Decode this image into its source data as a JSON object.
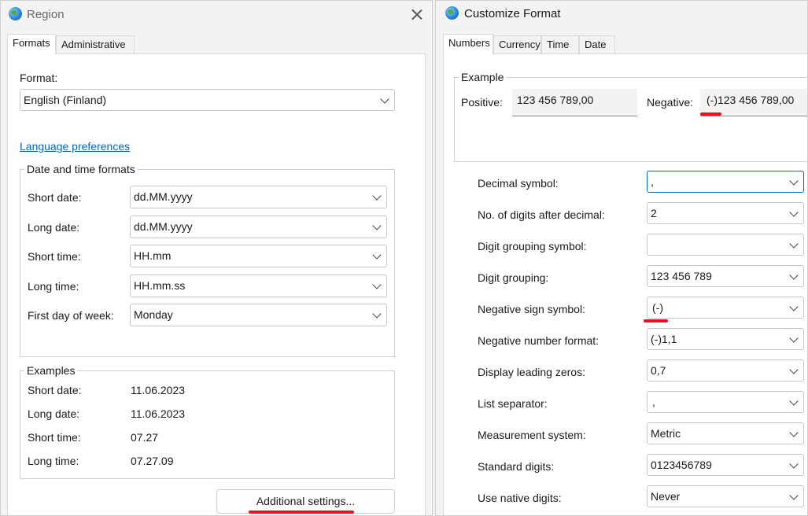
{
  "region": {
    "title": "Region",
    "tabs": [
      "Formats",
      "Administrative"
    ],
    "format_label": "Format:",
    "format_value": "English (Finland)",
    "language_link": "Language preferences",
    "datetime_group": "Date and time formats",
    "fields": [
      {
        "label": "Short date:",
        "value": "dd.MM.yyyy"
      },
      {
        "label": "Long date:",
        "value": "dd.MM.yyyy"
      },
      {
        "label": "Short time:",
        "value": "HH.mm"
      },
      {
        "label": "Long time:",
        "value": "HH.mm.ss"
      },
      {
        "label": "First day of week:",
        "value": "Monday"
      }
    ],
    "examples_group": "Examples",
    "examples": [
      {
        "label": "Short date:",
        "value": "11.06.2023"
      },
      {
        "label": "Long date:",
        "value": "11.06.2023"
      },
      {
        "label": "Short time:",
        "value": "07.27"
      },
      {
        "label": "Long time:",
        "value": "07.27.09"
      }
    ],
    "additional_button": "Additional settings..."
  },
  "customize": {
    "title": "Customize Format",
    "tabs": [
      "Numbers",
      "Currency",
      "Time",
      "Date"
    ],
    "example_group": "Example",
    "positive_label": "Positive:",
    "positive_value": "123 456 789,00",
    "negative_label": "Negative:",
    "negative_value": "(-)123 456 789,00",
    "settings": [
      {
        "label": "Decimal symbol:",
        "value": ","
      },
      {
        "label": "No. of digits after decimal:",
        "value": "2"
      },
      {
        "label": "Digit grouping symbol:",
        "value": ""
      },
      {
        "label": "Digit grouping:",
        "value": "123 456 789"
      },
      {
        "label": "Negative sign symbol:",
        "value": "(-)"
      },
      {
        "label": "Negative number format:",
        "value": "(-)1,1"
      },
      {
        "label": "Display leading zeros:",
        "value": "0,7"
      },
      {
        "label": "List separator:",
        "value": ","
      },
      {
        "label": "Measurement system:",
        "value": "Metric"
      },
      {
        "label": "Standard digits:",
        "value": "0123456789"
      },
      {
        "label": "Use native digits:",
        "value": "Never"
      }
    ]
  },
  "colors": {
    "accent": "#0067c0",
    "annotation": "#e81123"
  }
}
